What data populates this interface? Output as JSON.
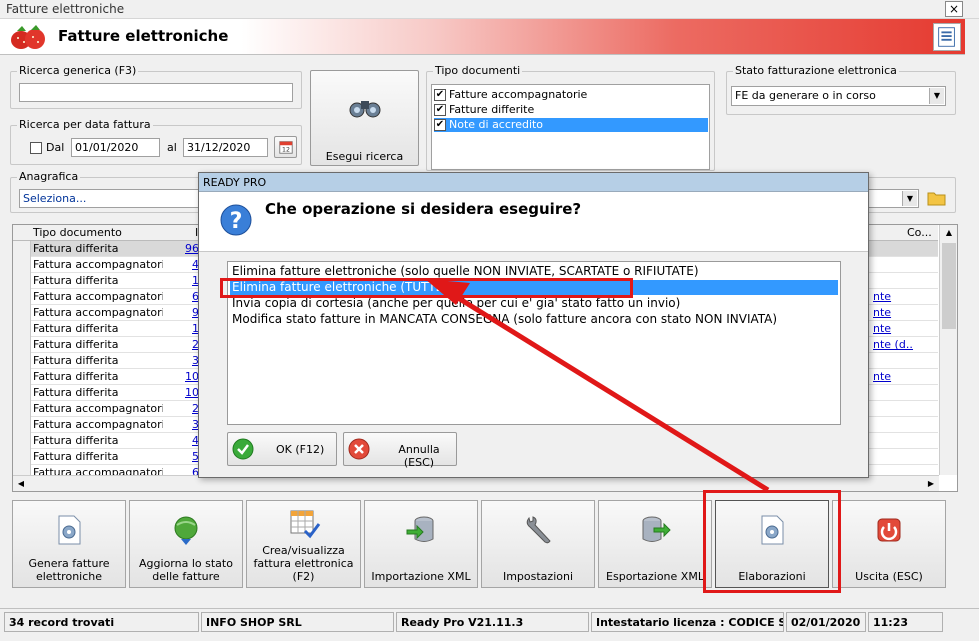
{
  "window": {
    "title": "Fatture elettroniche",
    "header_title": "Fatture elettroniche",
    "close_glyph": "×"
  },
  "search": {
    "generic_label": "Ricerca generica (F3)",
    "generic_value": "",
    "date_label": "Ricerca per data fattura",
    "dal_label": "Dal",
    "dal_checked": false,
    "from_date": "01/01/2020",
    "al_label": "al",
    "to_date": "31/12/2020",
    "button_label": "Esegui ricerca"
  },
  "doc_types": {
    "label": "Tipo documenti",
    "items": [
      {
        "label": "Fatture accompagnatorie",
        "checked": true
      },
      {
        "label": "Fatture differite",
        "checked": true
      },
      {
        "label": "Note di accredito",
        "checked": true
      }
    ]
  },
  "stato": {
    "label": "Stato fatturazione elettronica",
    "value": "FE da generare o in corso"
  },
  "anagrafica": {
    "label": "Anagrafica",
    "value": "Seleziona..."
  },
  "grid": {
    "headers": [
      "Tipo documento",
      "I",
      "Co..."
    ],
    "rows": [
      {
        "tipo": "Fattura differita",
        "num": "96",
        "co": ""
      },
      {
        "tipo": "Fattura accompagnatoria",
        "num": "4",
        "co": ""
      },
      {
        "tipo": "Fattura differita",
        "num": "1",
        "co": ""
      },
      {
        "tipo": "Fattura accompagnatoria",
        "num": "6",
        "co": "nte"
      },
      {
        "tipo": "Fattura accompagnatoria",
        "num": "9",
        "co": "nte"
      },
      {
        "tipo": "Fattura differita",
        "num": "1",
        "co": "nte"
      },
      {
        "tipo": "Fattura differita",
        "num": "2",
        "co": "nte (d..."
      },
      {
        "tipo": "Fattura differita",
        "num": "3",
        "co": ""
      },
      {
        "tipo": "Fattura differita",
        "num": "10",
        "co": "nte"
      },
      {
        "tipo": "Fattura differita",
        "num": "10",
        "co": ""
      },
      {
        "tipo": "Fattura accompagnatoria",
        "num": "2",
        "co": ""
      },
      {
        "tipo": "Fattura accompagnatoria",
        "num": "3",
        "co": ""
      },
      {
        "tipo": "Fattura differita",
        "num": "4",
        "co": ""
      },
      {
        "tipo": "Fattura differita",
        "num": "5",
        "co": ""
      },
      {
        "tipo": "Fattura accompagnatoria",
        "num": "6",
        "co": ""
      }
    ]
  },
  "toolbar": {
    "genera": "Genera fatture elettroniche",
    "aggiorna": "Aggiorna lo stato delle fatture",
    "crea": "Crea/visualizza fattura elettronica (F2)",
    "importazione": "Importazione XML",
    "impostazioni": "Impostazioni",
    "esportazione": "Esportazione XML",
    "elaborazioni": "Elaborazioni",
    "uscita": "Uscita (ESC)"
  },
  "status": {
    "records": "34 record trovati",
    "company": "INFO SHOP SRL",
    "version": "Ready Pro V21.11.3",
    "license": "Intestatario licenza : CODICE SRL",
    "date": "02/01/2020",
    "time": "11:23"
  },
  "dialog": {
    "title": "READY PRO",
    "question": "Che operazione si desidera eseguire?",
    "options": [
      "Elimina fatture elettroniche (solo quelle NON INVIATE, SCARTATE o RIFIUTATE)",
      "Elimina fatture elettroniche (TUTTE)",
      "Invia copia di cortesia (anche per quelle per cui e' gia' stato fatto un invio)",
      "Modifica stato fatture in MANCATA CONSEGNA (solo fatture ancora con stato NON INVIATA)"
    ],
    "selected_index": 1,
    "ok_label": "OK (F12)",
    "cancel_label": "Annulla (ESC)"
  },
  "colors": {
    "selection": "#3399ff",
    "annotation": "#e01818",
    "header_red": "#e53a30"
  }
}
